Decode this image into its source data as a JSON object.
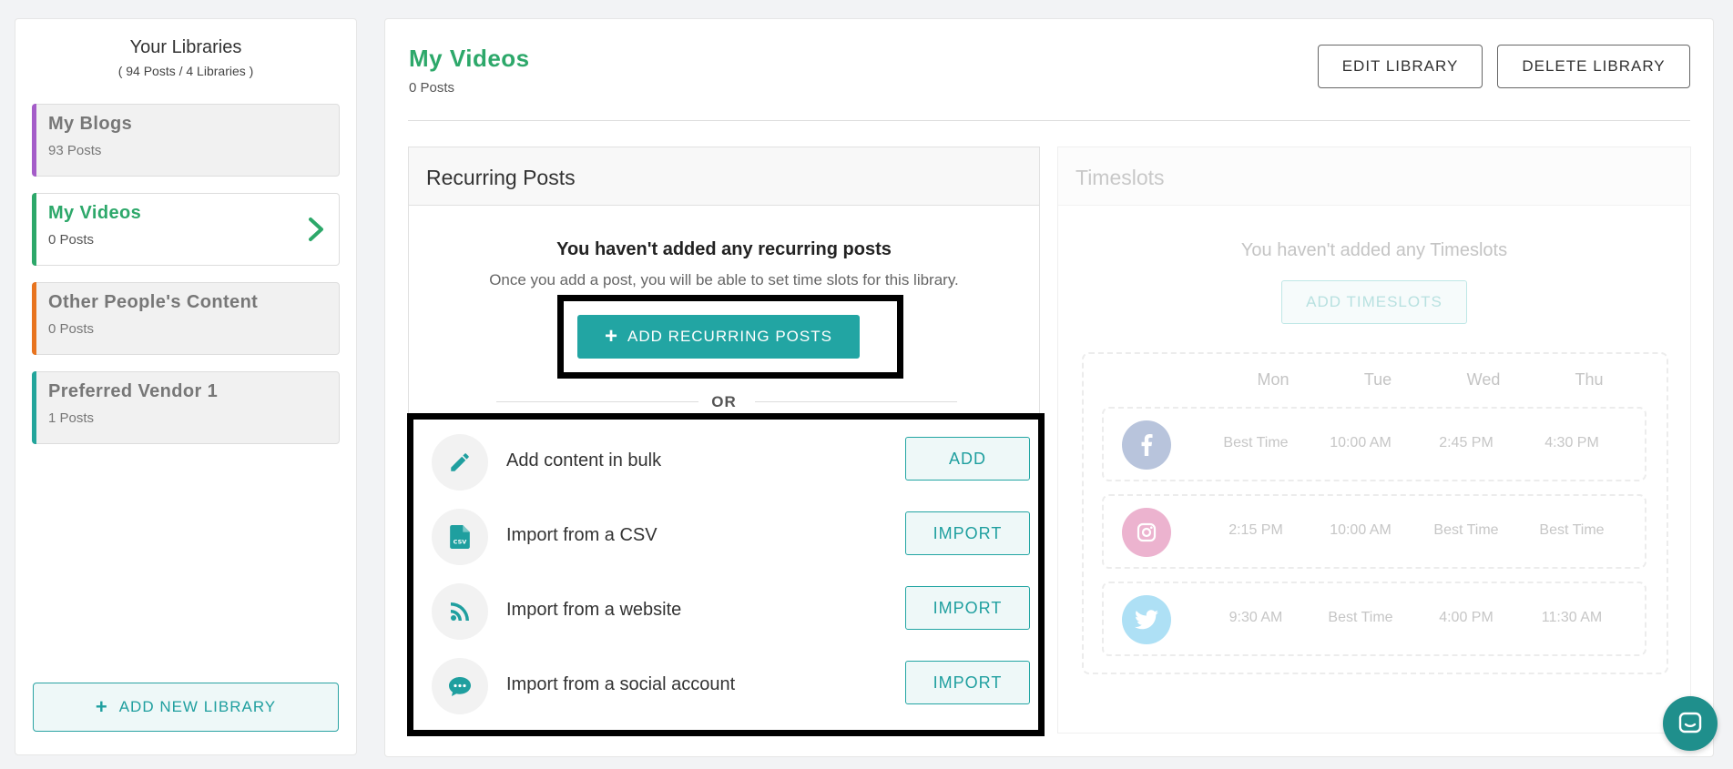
{
  "sidebar": {
    "title": "Your Libraries",
    "subtitle": "( 94 Posts / 4 Libraries )",
    "libraries": [
      {
        "name": "My Blogs",
        "count": "93 Posts",
        "color": "#a45cc8"
      },
      {
        "name": "My Videos",
        "count": "0 Posts",
        "color": "#2da86a",
        "active": true
      },
      {
        "name": "Other People's Content",
        "count": "0 Posts",
        "color": "#e8741f"
      },
      {
        "name": "Preferred Vendor 1",
        "count": "1 Posts",
        "color": "#22a59b"
      }
    ],
    "add_library_label": "ADD NEW LIBRARY"
  },
  "header": {
    "title": "My Videos",
    "subtitle": "0 Posts",
    "edit_label": "EDIT LIBRARY",
    "delete_label": "DELETE LIBRARY"
  },
  "recurring": {
    "heading": "Recurring Posts",
    "empty_title": "You haven't added any recurring posts",
    "empty_sub": "Once you add a post, you will be able to set time slots for this library.",
    "add_label": "ADD RECURRING POSTS",
    "or_label": "OR",
    "options": [
      {
        "icon": "pencil-icon",
        "label": "Add content in bulk",
        "button": "ADD"
      },
      {
        "icon": "csv-file-icon",
        "label": "Import from a CSV",
        "button": "IMPORT"
      },
      {
        "icon": "rss-icon",
        "label": "Import from a website",
        "button": "IMPORT"
      },
      {
        "icon": "chat-bubble-icon",
        "label": "Import from a social account",
        "button": "IMPORT"
      }
    ]
  },
  "timeslots": {
    "heading": "Timeslots",
    "empty_title": "You haven't added any Timeslots",
    "add_label": "ADD TIMESLOTS",
    "days": [
      "Mon",
      "Tue",
      "Wed",
      "Thu"
    ],
    "rows": [
      {
        "network": "facebook-icon",
        "color": "#b8c4dc",
        "times": [
          "Best Time",
          "10:00 AM",
          "2:45 PM",
          "4:30 PM"
        ]
      },
      {
        "network": "instagram-icon",
        "color": "#ecb3cf",
        "times": [
          "2:15 PM",
          "10:00 AM",
          "Best Time",
          "Best Time"
        ]
      },
      {
        "network": "twitter-icon",
        "color": "#aee0f5",
        "times": [
          "9:30 AM",
          "Best Time",
          "4:00 PM",
          "11:30 AM"
        ]
      }
    ]
  }
}
